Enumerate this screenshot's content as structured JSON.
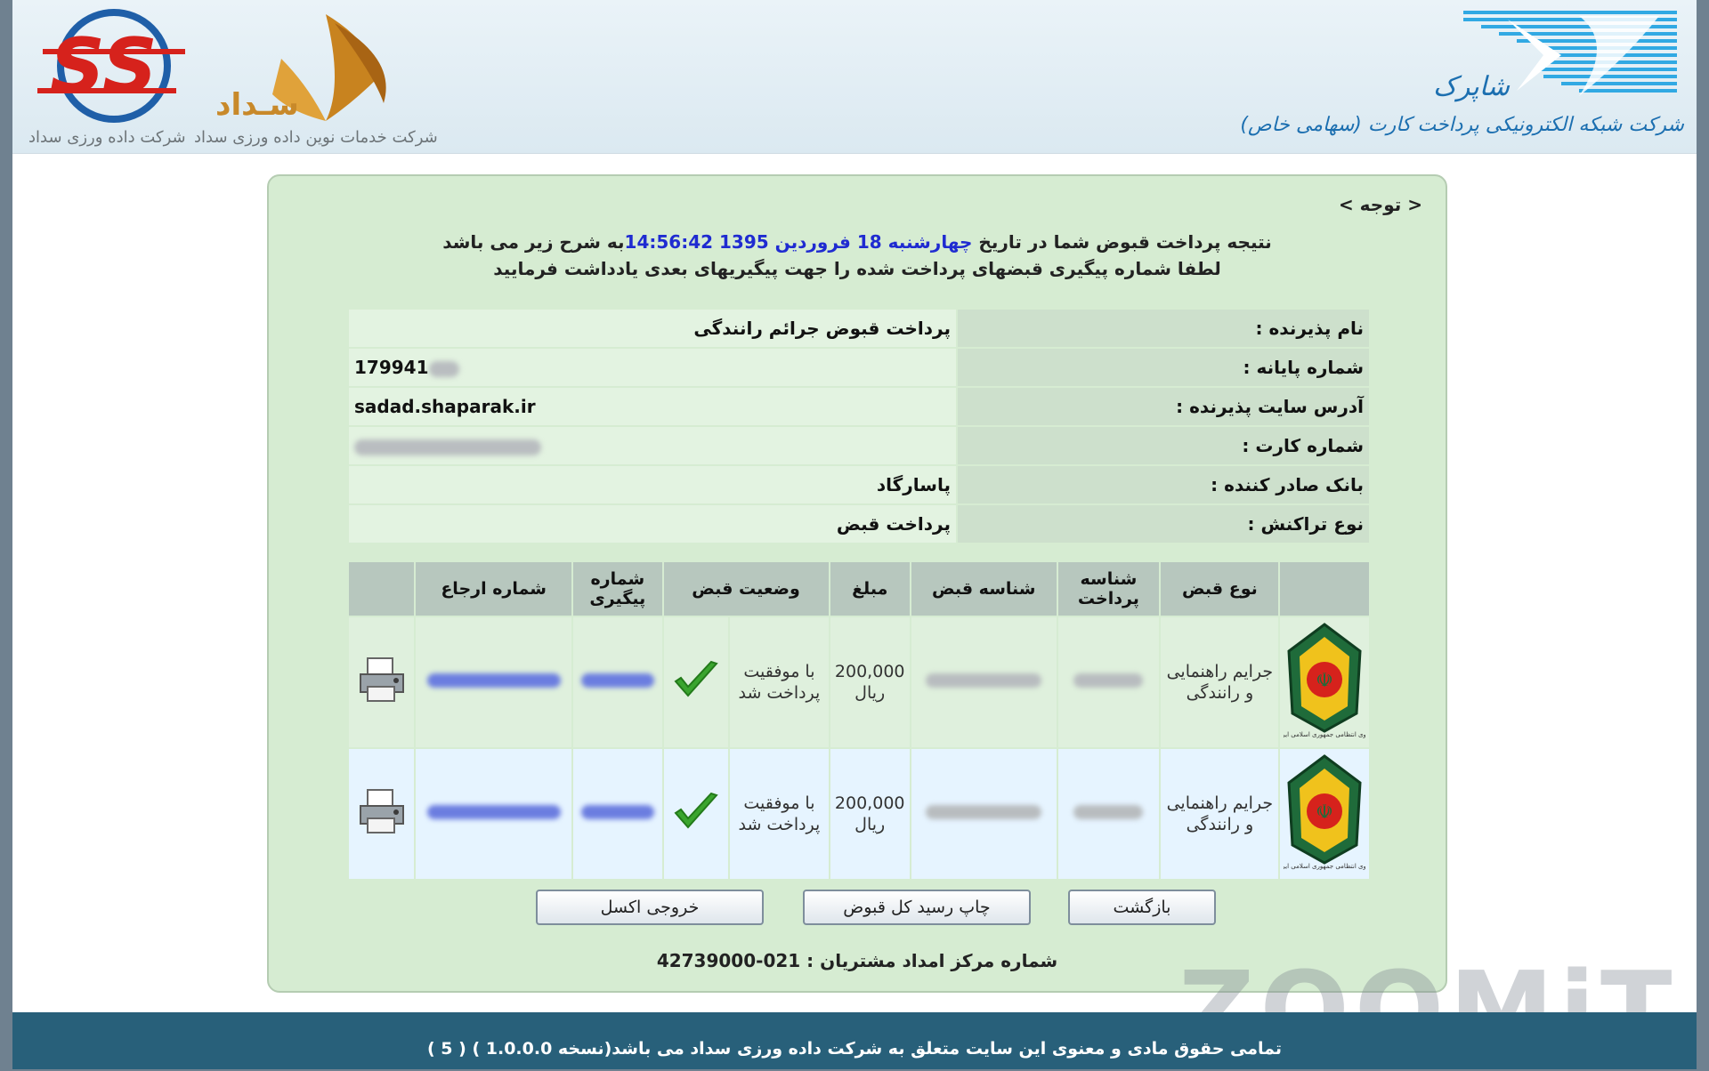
{
  "header": {
    "shaparak_caption": "شرکت شبکه الکترونیکی پرداخت کارت (سهامی خاص)",
    "shaparak_word": "شاپرک",
    "sadad_word": "سـداد",
    "sadad_caption": "شرکت خدمات نوین داده ورزی سداد",
    "sds_caption": "شرکت داده ورزی سداد"
  },
  "notice": {
    "title": "< توجه >",
    "line1_prefix": "نتیجه پرداخت قبوض شما در تاریخ ",
    "line1_date": "چهارشنبه 18 فروردین 1395 14:56:42",
    "line1_suffix": "به شرح زیر می باشد",
    "line2": "لطفا شماره پیگیری قبضهای پرداخت شده را جهت پیگیریهای بعدی یادداشت فرمایید"
  },
  "info": {
    "merchant_label": "نام پذیرنده :",
    "merchant_value": "پرداخت قبوض جرائم رانندگی",
    "terminal_label": "شماره پایانه :",
    "terminal_value": "179941",
    "site_label": "آدرس سایت پذیرنده :",
    "site_value": "sadad.shaparak.ir",
    "card_label": "شماره کارت :",
    "bank_label": "بانک صادر کننده :",
    "bank_value": "پاسارگاد",
    "txn_label": "نوع تراکنش :",
    "txn_value": "پرداخت قبض"
  },
  "bills": {
    "headers": {
      "type": "نوع قبض",
      "payment_id": "شناسه پرداخت",
      "bill_id": "شناسه قبض",
      "amount": "مبلغ",
      "status": "وضعیت قبض",
      "tracking": "شماره پیگیری",
      "reference": "شماره ارجاع"
    },
    "rows": [
      {
        "type": "جرایم راهنمایی و رانندگی",
        "amount": "200,000",
        "unit": "ریال",
        "status": "با موفقیت پرداخت شد"
      },
      {
        "type": "جرایم راهنمایی و رانندگی",
        "amount": "200,000",
        "unit": "ریال",
        "status": "با موفقیت پرداخت شد"
      }
    ],
    "badge_caption": "نیروی انتظامی جمهوری اسلامی ایران"
  },
  "buttons": {
    "back": "بازگشت",
    "print_all": "چاپ رسید کل قبوض",
    "excel": "خروجی اکسل"
  },
  "support": "شماره مرکز امداد مشتریان : 021-42739000",
  "footer": "تمامی حقوق مادی و معنوی این سایت متعلق به شرکت داده ورزی سداد می باشد(نسخه 1.0.0.0 ) ( 5 )",
  "watermark": "ZOOMiT",
  "colors": {
    "panel_bg": "#d6ecd2",
    "footer_bg": "#28607a",
    "date_highlight": "#1f2bd1",
    "success_check": "#3aa52e"
  }
}
